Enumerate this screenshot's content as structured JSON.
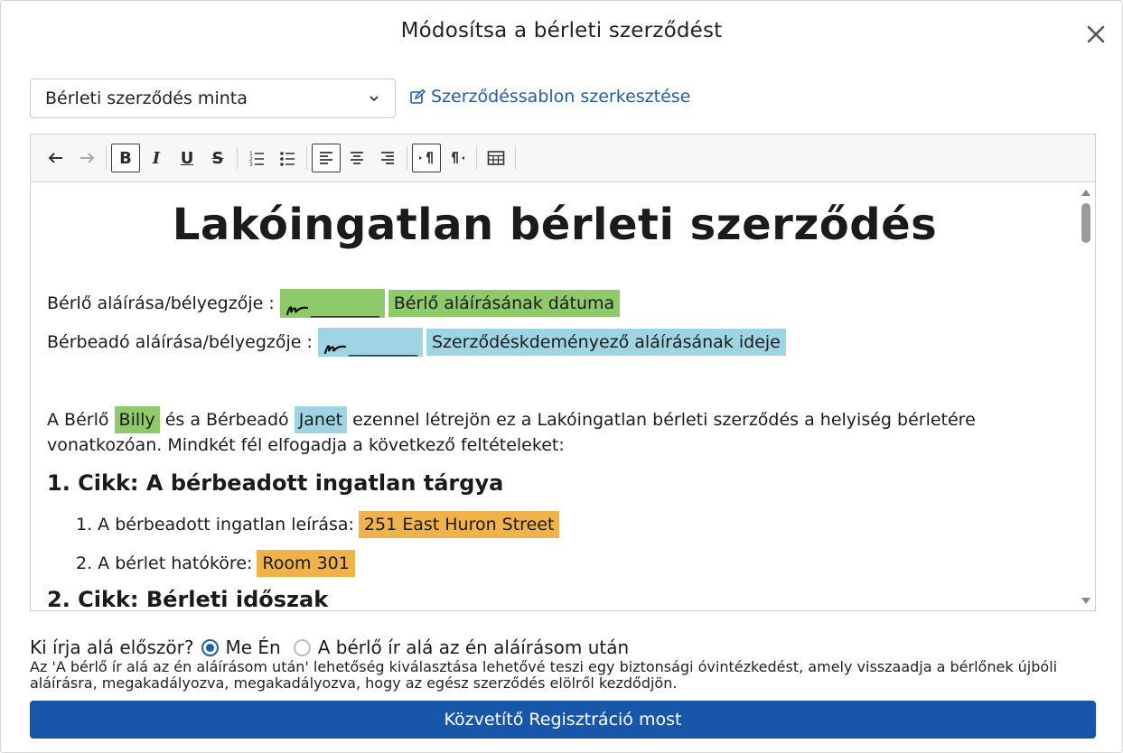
{
  "modal": {
    "title": "Módosítsa a bérleti szerződést"
  },
  "template": {
    "selected": "Bérleti szerződés minta",
    "edit_link": "Szerződéssablon szerkesztése"
  },
  "toolbar": {
    "bold": "B",
    "italic": "I",
    "underline": "U",
    "strike": "S"
  },
  "document": {
    "title": "Lakóingatlan bérleti szerződés",
    "tenant_sig_label": "Bérlő aláírása/bélyegzője :",
    "tenant_sig_line": "________",
    "tenant_date": "Bérlő aláírásának dátuma",
    "landlord_sig_label": "Bérbeadó aláírása/bélyegzője :",
    "landlord_sig_line": "________",
    "landlord_date": "Szerződéskdeményező aláírásának ideje",
    "intro_1": "A Bérlő",
    "tenant_name": "Billy",
    "intro_2": "és a Bérbeadó",
    "landlord_name": "Janet",
    "intro_3": "ezennel létrejön ez a Lakóingatlan bérleti szerződés a helyiség bérletére vonatkozóan. Mindkét fél elfogadja a következő feltételeket:",
    "article1": "1. Cikk: A bérbeadott ingatlan tárgya",
    "item1_label": "1. A bérbeadott ingatlan leírása:",
    "item1_value": "251 East Huron Street",
    "item2_label": "2. A bérlet hatóköre:",
    "item2_value": "Room 301",
    "article2": "2. Cikk: Bérleti időszak"
  },
  "signer": {
    "question": "Ki írja alá először?",
    "option_me": "Me Én",
    "option_tenant": "A bérlő ír alá az én aláírásom után",
    "selected": "option_me",
    "note": "Az 'A bérlő ír alá az én aláírásom után' lehetőség kiválasztása lehetővé teszi egy biztonsági óvintézkedést, amely visszaadja a bérlőnek újbóli aláírásra, megakadályozva, megakadályozva, hogy az egész szerződés elölről kezdődjön."
  },
  "submit_label": "Közvetítő Regisztráció most",
  "colors": {
    "primary": "#1756a9",
    "link": "#1f5fa8",
    "highlight_green": "#8ec96a",
    "highlight_blue": "#9fd4e3",
    "highlight_orange": "#f0b24a"
  }
}
